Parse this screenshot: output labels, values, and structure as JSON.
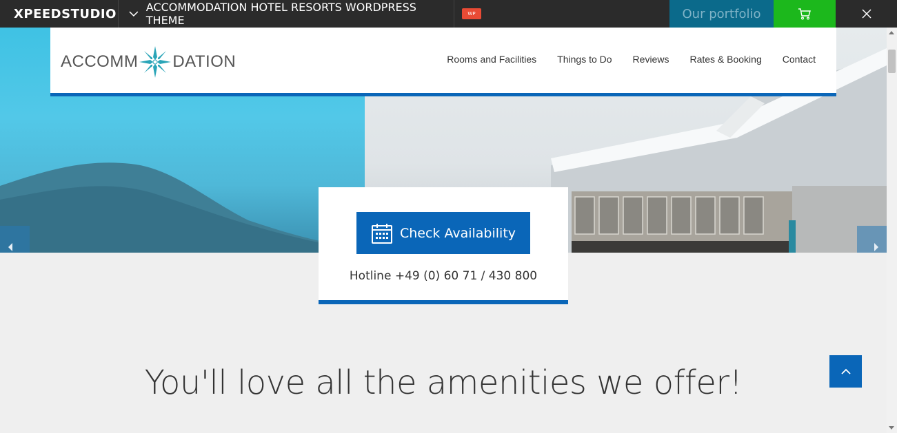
{
  "topbar": {
    "brand": "XPEEDSTUDIO",
    "theme_title": "ACCOMMODATION HOTEL RESORTS WORDPRESS THEME",
    "badge": "WP",
    "portfolio_label": "Our portfolio"
  },
  "header": {
    "logo_left": "ACCOMM",
    "logo_right": "DATION",
    "nav": [
      "Rooms and Facilities",
      "Things to Do",
      "Reviews",
      "Rates & Booking",
      "Contact"
    ]
  },
  "booking": {
    "button_label": "Check Availability",
    "hotline": "Hotline +49 (0) 60 71 / 430 800"
  },
  "main": {
    "heading": "You'll love all the amenities we offer!"
  },
  "colors": {
    "accent": "#0a66b8",
    "topbar": "#2b2b2b",
    "portfolio": "#0b6a8b",
    "cart": "#1cb81c",
    "badge": "#e94b35"
  }
}
